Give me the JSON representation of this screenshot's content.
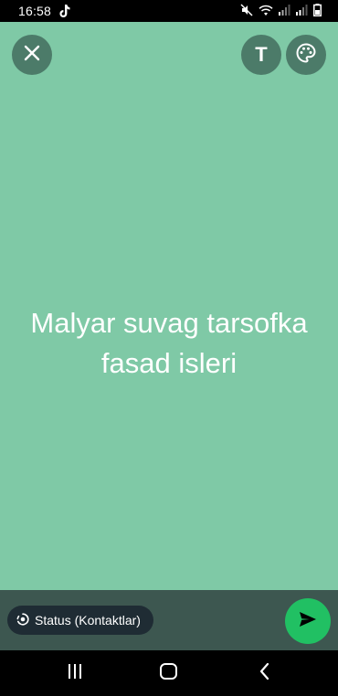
{
  "status_bar": {
    "time": "16:58"
  },
  "toolbar": {
    "text_tool_glyph": "T"
  },
  "status": {
    "text_line1": "Malyar suvag tarsofka",
    "text_line2": "fasad isleri",
    "background_color": "#7fc9a6"
  },
  "bottom": {
    "audience_label": "Status (Kontaktlar)"
  },
  "icons": {
    "close": "close-icon",
    "text_tool": "text-tool-icon",
    "palette": "palette-icon",
    "audience": "status-icon",
    "send": "send-icon",
    "nav_recent": "recent-apps-icon",
    "nav_home": "home-icon",
    "nav_back": "back-icon"
  },
  "colors": {
    "button_bg": "#4c7b69",
    "send_button": "#21c063",
    "bottom_bar": "#3d5750",
    "chip_bg": "#1f2c34"
  }
}
